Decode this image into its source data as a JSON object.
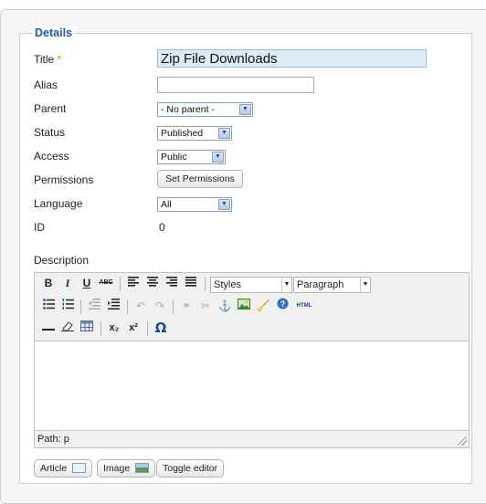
{
  "form": {
    "legend": "Details",
    "title_label": "Title",
    "required_mark": "*",
    "title_value": "Zip File Downloads",
    "alias_label": "Alias",
    "alias_value": "",
    "parent_label": "Parent",
    "parent_selected": "- No parent -",
    "status_label": "Status",
    "status_selected": "Published",
    "access_label": "Access",
    "access_selected": "Public",
    "permissions_label": "Permissions",
    "permissions_button": "Set Permissions",
    "language_label": "Language",
    "language_selected": "All",
    "id_label": "ID",
    "id_value": "0",
    "description_label": "Description"
  },
  "editor": {
    "styles_selected": "Styles",
    "format_selected": "Paragraph",
    "path_text": "Path: p",
    "html_label": "HTML",
    "toolbar_text": {
      "bold": "B",
      "italic": "I",
      "underline": "U",
      "strike": "ABC",
      "subscript": "x₂",
      "superscript": "x²",
      "omega": "Ω"
    }
  },
  "buttons": {
    "article": "Article",
    "image": "Image",
    "toggle_editor": "Toggle editor"
  },
  "icons": [
    "bold-icon",
    "italic-icon",
    "underline-icon",
    "strikethrough-icon",
    "align-left-icon",
    "align-center-icon",
    "align-right-icon",
    "align-justify-icon",
    "bullet-list-icon",
    "numbered-list-icon",
    "outdent-icon",
    "indent-icon",
    "undo-icon",
    "redo-icon",
    "link-icon",
    "unlink-icon",
    "anchor-icon",
    "image-icon",
    "cleanup-icon",
    "help-icon",
    "html-icon",
    "horizontal-rule-icon",
    "eraser-icon",
    "table-icon",
    "subscript-icon",
    "superscript-icon",
    "special-char-icon"
  ]
}
